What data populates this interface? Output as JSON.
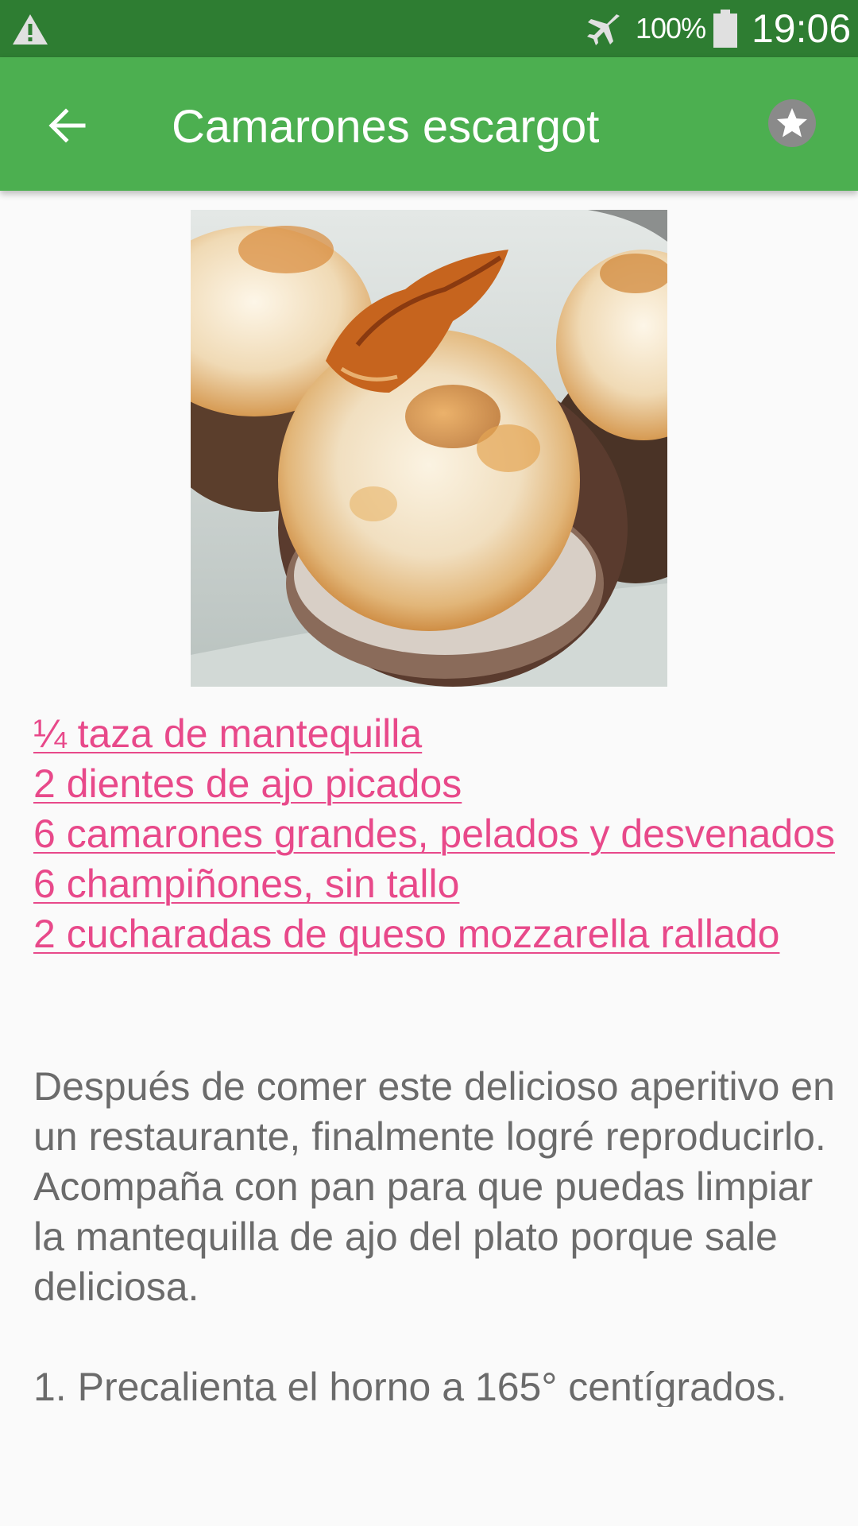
{
  "status_bar": {
    "battery": "100%",
    "time": "19:06",
    "icons": [
      "warning-icon",
      "airplane-mode-icon",
      "battery-icon"
    ]
  },
  "app_bar": {
    "title": "Camarones escargot",
    "icons": [
      "back-arrow-icon",
      "star-favorite-icon"
    ]
  },
  "recipe": {
    "image_alt": "shrimp-stuffed-mushrooms-photo",
    "ingredients": [
      "¼ taza de mantequilla",
      "2 dientes de ajo picados",
      "6 camarones grandes, pelados y desvenados",
      "6 champiñones, sin tallo",
      "2 cucharadas de queso mozzarella rallado"
    ],
    "description": "Después de comer este delicioso aperitivo en un restaurante, finalmente logré reproducirlo. Acompaña con pan para que puedas limpiar la mantequilla de ajo del plato porque sale deliciosa.",
    "steps": [
      "1. Precalienta el horno a 165° centígrados."
    ]
  },
  "colors": {
    "status_bar": "#2e7d32",
    "app_bar": "#4caf50",
    "ingredient_link": "#e8498a",
    "body_text": "#6b6b6b",
    "background": "#fafafa"
  }
}
